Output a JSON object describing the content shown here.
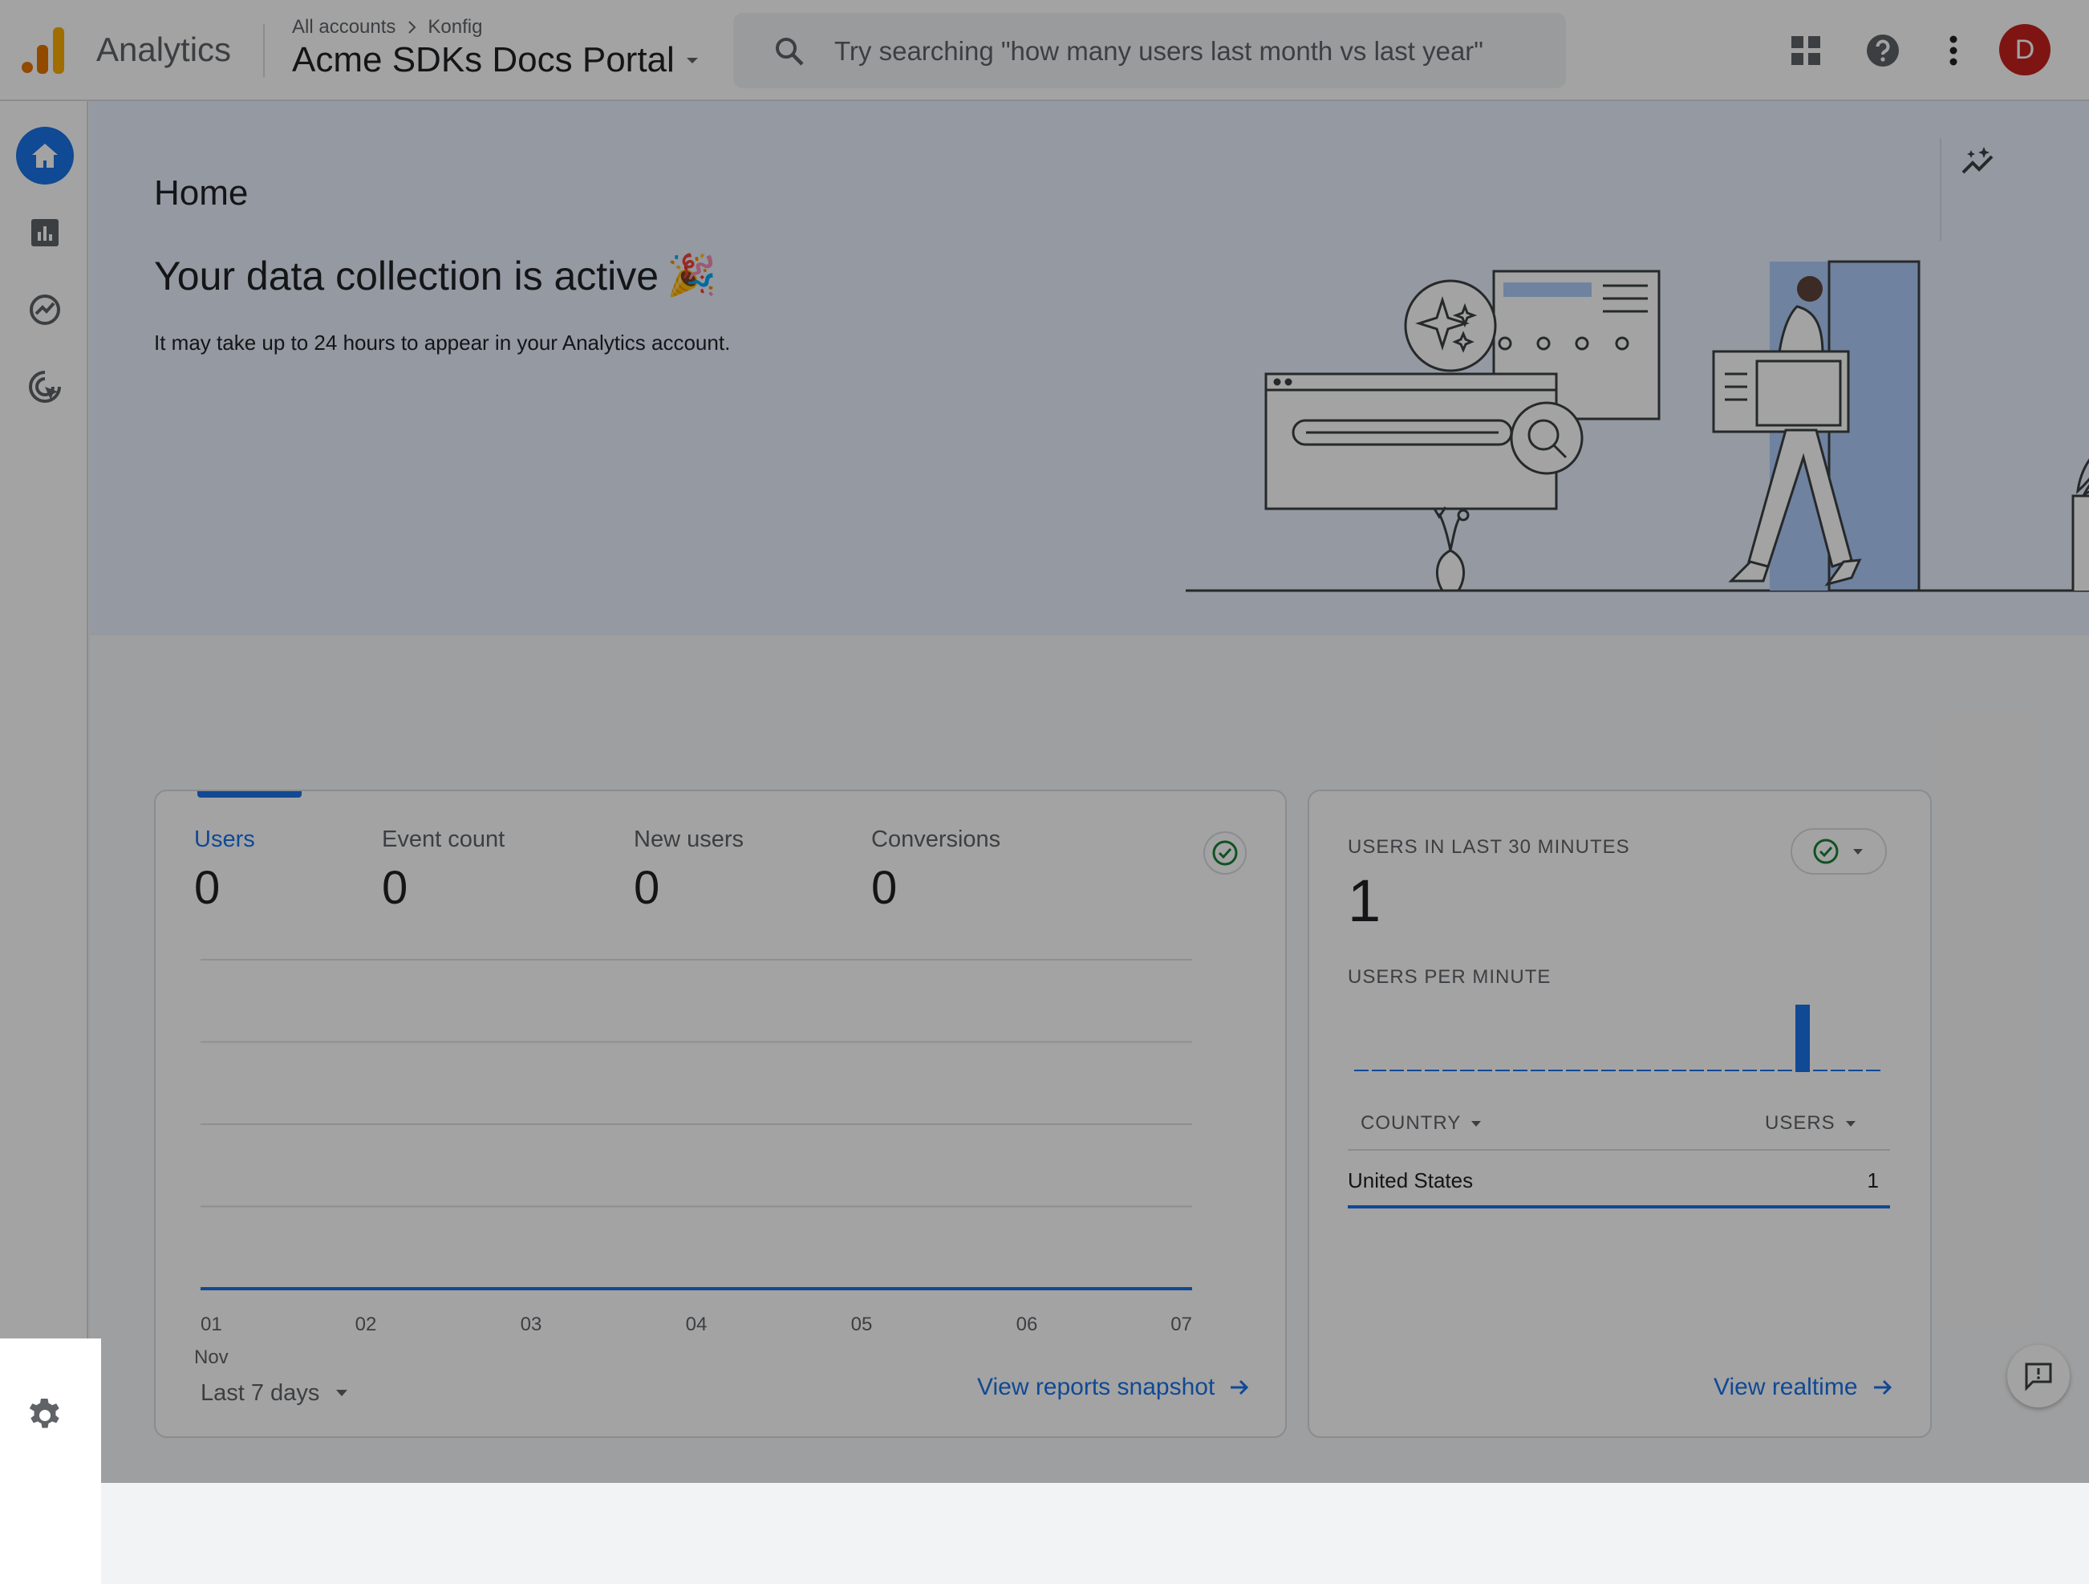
{
  "topbar": {
    "app_name": "Analytics",
    "breadcrumb": {
      "accounts": "All accounts",
      "account": "Konfig"
    },
    "property": "Acme SDKs Docs Portal",
    "search_placeholder": "Try searching \"how many users last month vs last year\"",
    "avatar_initial": "D"
  },
  "colors": {
    "accent": "#1a73e8",
    "avatar": "#c5221f",
    "success": "#188038"
  },
  "sidebar": {
    "items": [
      {
        "name": "home",
        "icon": "home-icon",
        "active": true
      },
      {
        "name": "reports",
        "icon": "bar-chart-icon"
      },
      {
        "name": "explore",
        "icon": "explore-icon"
      },
      {
        "name": "advertising",
        "icon": "target-cursor-icon"
      }
    ],
    "settings_icon": "gear-icon"
  },
  "hero": {
    "page_title": "Home",
    "heading": "Your data collection is active",
    "heading_emoji": "🎉",
    "subtitle": "It may take up to 24 hours to appear in your Analytics account."
  },
  "overview": {
    "metrics": [
      {
        "label": "Users",
        "value": "0"
      },
      {
        "label": "Event count",
        "value": "0"
      },
      {
        "label": "New users",
        "value": "0"
      },
      {
        "label": "Conversions",
        "value": "0"
      }
    ],
    "date_range": "Last 7 days",
    "snapshot_link": "View reports snapshot",
    "x_month": "Nov"
  },
  "chart_data": {
    "type": "line",
    "x": [
      "01",
      "02",
      "03",
      "04",
      "05",
      "06",
      "07"
    ],
    "series": [
      {
        "values": [
          0,
          0,
          0,
          0,
          0,
          0,
          0
        ]
      }
    ],
    "grid": true
  },
  "realtime": {
    "title": "USERS IN LAST 30 MINUTES",
    "total": "1",
    "per_minute_label": "USERS PER MINUTE",
    "per_minute": [
      0,
      0,
      0,
      0,
      0,
      0,
      0,
      0,
      0,
      0,
      0,
      0,
      0,
      0,
      0,
      0,
      0,
      0,
      0,
      0,
      0,
      0,
      0,
      0,
      0,
      1,
      0,
      0,
      0,
      0
    ],
    "col_country": "COUNTRY",
    "col_users": "USERS",
    "rows": [
      {
        "country": "United States",
        "users": "1"
      }
    ],
    "link": "View realtime"
  }
}
